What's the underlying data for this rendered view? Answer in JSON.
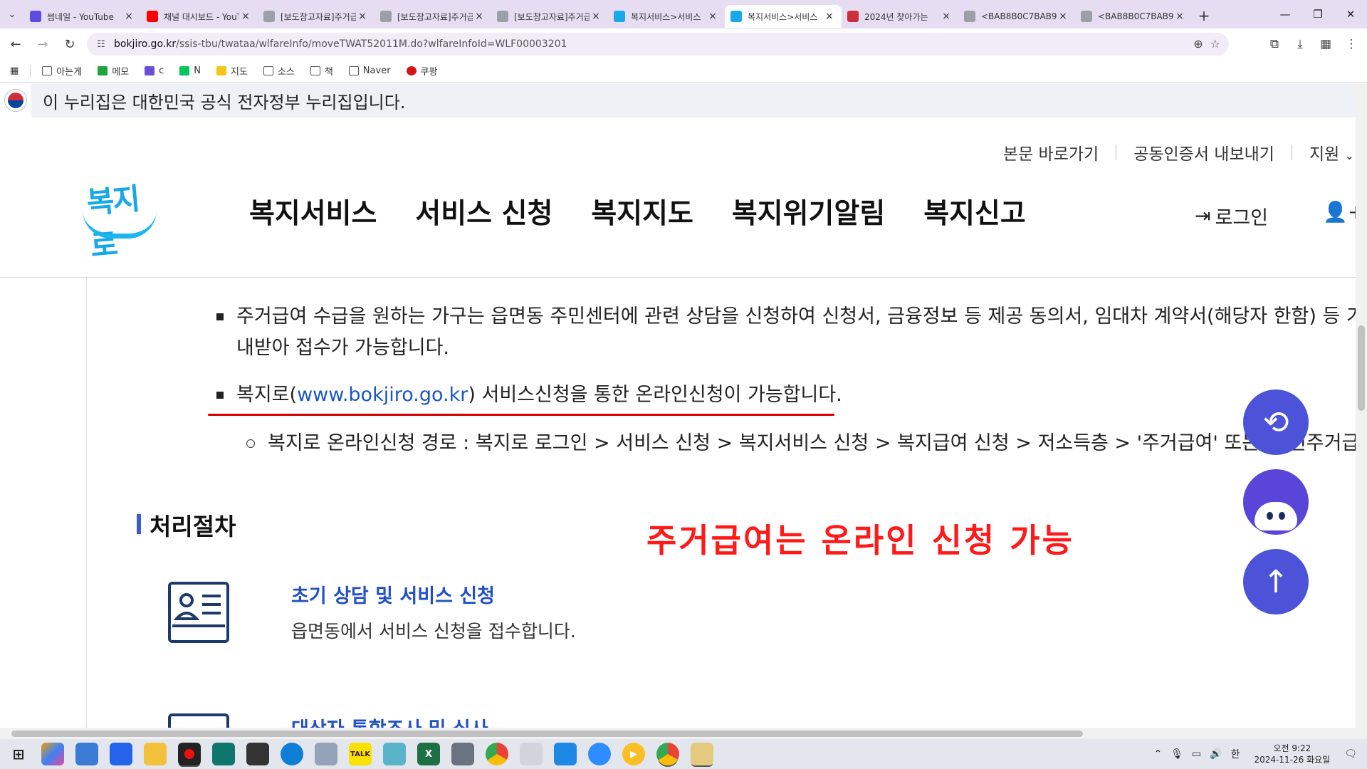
{
  "browser": {
    "tabs": [
      {
        "title": "썸네일 - YouTube",
        "favicon_color": "#5b4be0",
        "active": false
      },
      {
        "title": "채널 대시보드 - YouTube",
        "favicon_color": "#ff0000",
        "active": false
      },
      {
        "title": "[보도참고자료]주거급여",
        "favicon_color": "#9aa0a6",
        "active": false
      },
      {
        "title": "[보도참고자료]주거급여",
        "favicon_color": "#9aa0a6",
        "active": false
      },
      {
        "title": "[보도참고자료]주거급여",
        "favicon_color": "#9aa0a6",
        "active": false
      },
      {
        "title": "복지서비스>서비스",
        "favicon_color": "#16a8e8",
        "active": false
      },
      {
        "title": "복지서비스>서비스",
        "favicon_color": "#16a8e8",
        "active": true
      },
      {
        "title": "2024년 찾아가는",
        "favicon_color": "#cd2e3a",
        "active": false
      },
      {
        "title": "<BAB8B0C7BAB9",
        "favicon_color": "#9aa0a6",
        "active": false
      },
      {
        "title": "<BAB8B0C7BAB9",
        "favicon_color": "#9aa0a6",
        "active": false
      }
    ],
    "url_host": "bokjiro.go.kr",
    "url_path": "/ssis-tbu/twataa/wlfareInfo/moveTWAT52011M.do?wlfareInfoId=WLF00003201",
    "bookmarks": [
      {
        "label": "아는게",
        "type": "folder"
      },
      {
        "label": "메모",
        "type": "green"
      },
      {
        "label": "c",
        "type": "calendar"
      },
      {
        "label": "N",
        "type": "naver"
      },
      {
        "label": "지도",
        "type": "map"
      },
      {
        "label": "소스",
        "type": "folder"
      },
      {
        "label": "책",
        "type": "folder"
      },
      {
        "label": "Naver",
        "type": "folder"
      },
      {
        "label": "쿠팡",
        "type": "coupang"
      }
    ]
  },
  "page": {
    "gov_banner": "이 누리집은 대한민국 공식 전자정부 누리집입니다.",
    "utility": [
      "본문 바로가기",
      "공동인증서 내보내기",
      "지원"
    ],
    "logo_text": "복지로",
    "gnb": [
      "복지서비스",
      "서비스 신청",
      "복지지도",
      "복지위기알림",
      "복지신고"
    ],
    "login": "로그인",
    "bullets": {
      "b1_line1": "주거급여 수급을 원하는 가구는 읍면동 주민센터에 관련 상담을 신청하여 신청서, 금융정보 등 제공 동의서, 임대차 계약서(해당자 한함) 등 기타 구비",
      "b1_line2": "내받아 접수가 가능합니다.",
      "b2_pre": "복지로(",
      "b2_link": "www.bokjiro.go.kr",
      "b2_post": ") 서비스신청을 통한 온라인신청이 가능합니다.",
      "b3": "복지로 온라인신청 경로 : 복지로 로그인 > 서비스 신청 > 복지서비스 신청 > 복지급여 신청 > 저소득층 > '주거급여' 또는 '청년주거급여분리지급'"
    },
    "section_title": "처리절차",
    "annotation": "주거급여는 온라인 신청 가능",
    "steps": [
      {
        "title": "초기 상담 및 서비스 신청",
        "desc": "읍면동에서 서비스 신청을 접수합니다."
      },
      {
        "title": "대상자 통합조사 및 심사",
        "desc": ""
      }
    ]
  },
  "taskbar": {
    "clock_time": "오전 9:22",
    "clock_date": "2024-11-26 화요일",
    "ime": "한"
  }
}
